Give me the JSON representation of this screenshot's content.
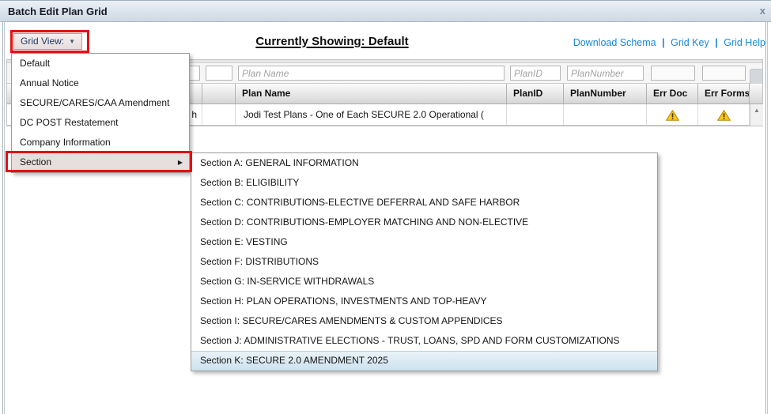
{
  "window": {
    "title": "Batch Edit Plan Grid",
    "close_glyph": "x"
  },
  "icons": {
    "caret_down": "▼",
    "caret_right": "▶",
    "caret_up": "▲"
  },
  "toolbar": {
    "grid_view_label": "Grid View:",
    "currently_showing": "Currently Showing: Default",
    "links": [
      "Download Schema",
      "Grid Key",
      "Grid Help"
    ],
    "links_separator": "|"
  },
  "grid": {
    "filters": [
      {
        "placeholder": "Plan Name"
      },
      {
        "placeholder": "PlanID"
      },
      {
        "placeholder": "PlanNumber"
      }
    ],
    "columns": [
      "Plan Name",
      "PlanID",
      "PlanNumber",
      "Err Doc",
      "Err Forms"
    ],
    "rows": [
      {
        "first_col_text": "h",
        "plan_name": "Jodi Test Plans - One of Each SECURE 2.0 Operational (",
        "plan_id": "",
        "plan_number": "",
        "err_doc": "warning",
        "err_forms": "warning"
      }
    ]
  },
  "grid_view_menu": {
    "items": [
      "Default",
      "Annual Notice",
      "SECURE/CARES/CAA Amendment",
      "DC POST Restatement",
      "Company Information",
      "Section"
    ],
    "highlighted_item": "Section",
    "submenu": {
      "items": [
        "Section A: GENERAL INFORMATION",
        "Section B: ELIGIBILITY",
        "Section C: CONTRIBUTIONS-ELECTIVE DEFERRAL AND SAFE HARBOR",
        "Section D: CONTRIBUTIONS-EMPLOYER MATCHING AND NON-ELECTIVE",
        "Section E: VESTING",
        "Section F: DISTRIBUTIONS",
        "Section G: IN-SERVICE WITHDRAWALS",
        "Section H: PLAN OPERATIONS, INVESTMENTS AND TOP-HEAVY",
        "Section I: SECURE/CARES AMENDMENTS & CUSTOM APPENDICES",
        "Section J: ADMINISTRATIVE ELECTIONS - TRUST, LOANS, SPD AND FORM CUSTOMIZATIONS",
        "Section K: SECURE 2.0 AMENDMENT 2025"
      ],
      "highlighted_item": "Section K: SECURE 2.0 AMENDMENT 2025"
    }
  },
  "colors": {
    "annotation_red": "#e01212",
    "link_blue": "#1b87d4",
    "submenu_highlight_blue": "#cde2ef",
    "menu_highlight_gray": "#e7dede",
    "warning_yellow": "#ffc90e"
  }
}
